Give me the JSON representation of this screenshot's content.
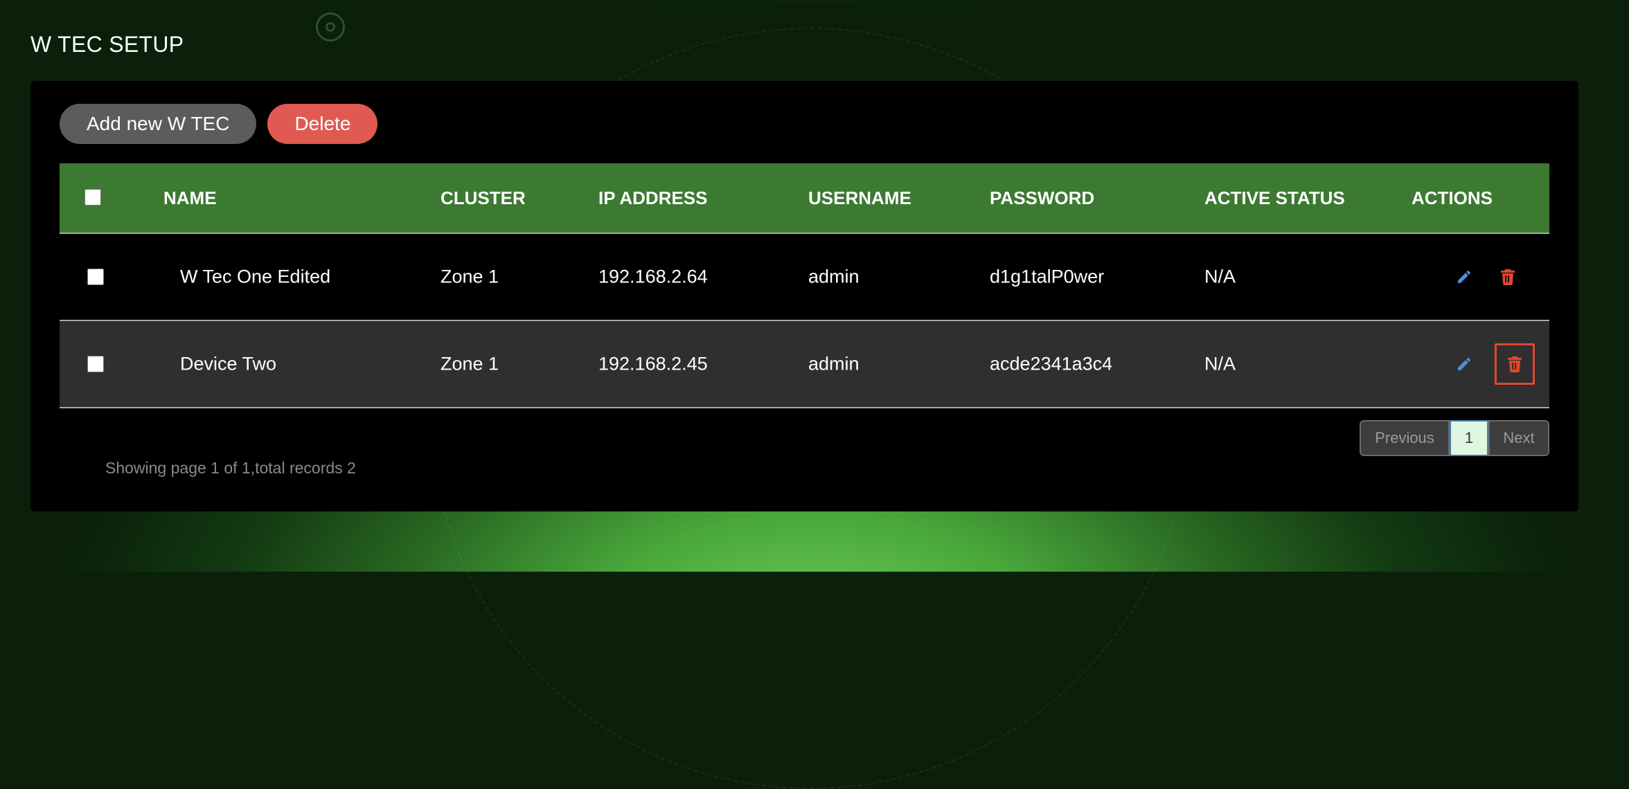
{
  "page": {
    "title": "W TEC SETUP"
  },
  "toolbar": {
    "add_label": "Add new W TEC",
    "delete_label": "Delete"
  },
  "table": {
    "headers": [
      "NAME",
      "CLUSTER",
      "IP ADDRESS",
      "USERNAME",
      "PASSWORD",
      "ACTIVE STATUS",
      "ACTIONS"
    ],
    "rows": [
      {
        "name": "W Tec One Edited",
        "cluster": "Zone 1",
        "ip": "192.168.2.64",
        "username": "admin",
        "password": "d1g1talP0wer",
        "status": "N/A"
      },
      {
        "name": "Device Two",
        "cluster": "Zone 1",
        "ip": "192.168.2.45",
        "username": "admin",
        "password": "acde2341a3c4",
        "status": "N/A"
      }
    ]
  },
  "pagination": {
    "previous_label": "Previous",
    "current_page": "1",
    "next_label": "Next"
  },
  "footer": {
    "info": "Showing page 1 of 1,total records 2"
  },
  "colors": {
    "header_bg": "#3c7a31",
    "delete_btn": "#e05a52",
    "edit_icon": "#4a90d9",
    "trash_icon": "#e0482e"
  },
  "icons": {
    "edit": "pencil-icon",
    "delete": "trash-icon"
  }
}
